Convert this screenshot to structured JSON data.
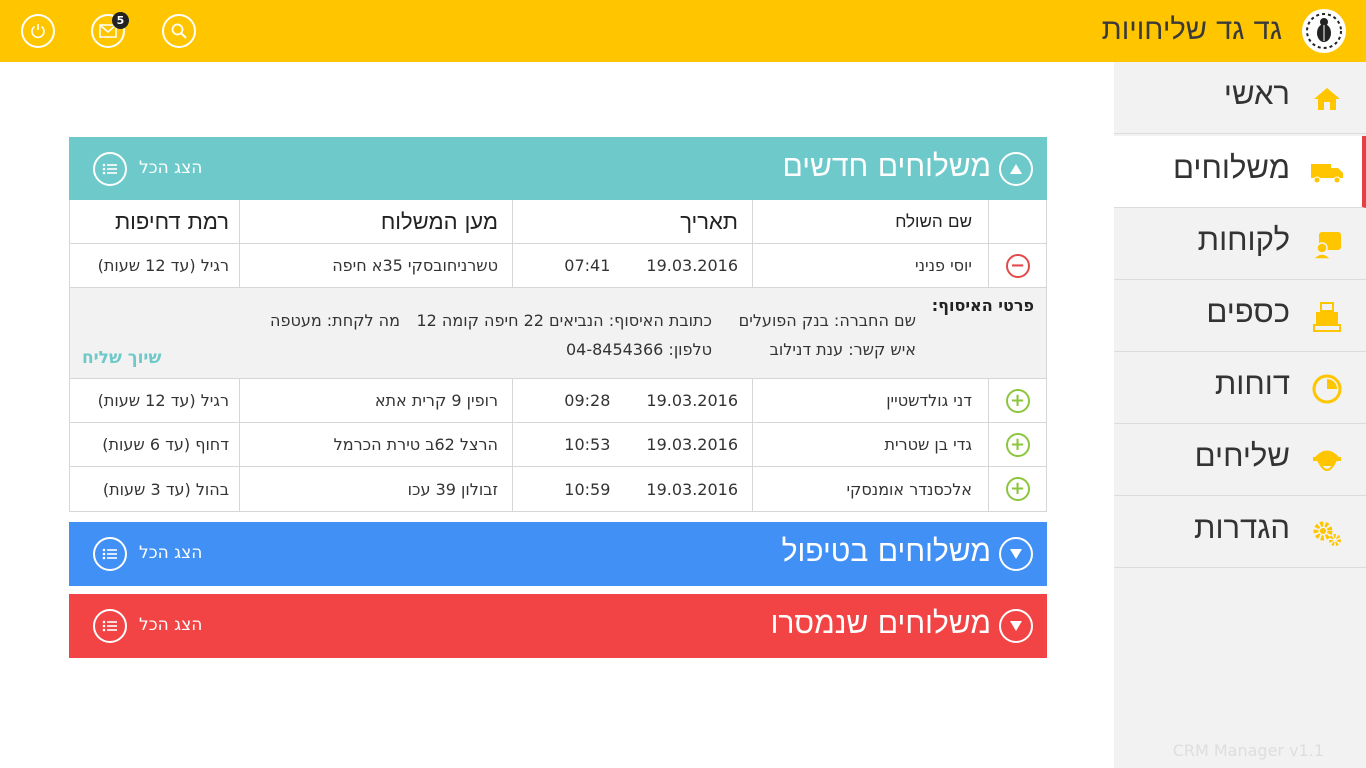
{
  "header": {
    "app_title": "גד גד שליחויות",
    "mail_badge": "5",
    "buttons": [
      "power-icon",
      "mail-icon",
      "search-icon"
    ]
  },
  "sidebar": {
    "items": [
      {
        "label": "ראשי",
        "icon": "home-icon"
      },
      {
        "label": "משלוחים",
        "icon": "truck-icon"
      },
      {
        "label": "לקוחות",
        "icon": "customers-icon"
      },
      {
        "label": "כספים",
        "icon": "cash-register-icon"
      },
      {
        "label": "דוחות",
        "icon": "pie-chart-icon"
      },
      {
        "label": "שליחים",
        "icon": "courier-icon"
      },
      {
        "label": "הגדרות",
        "icon": "gears-icon"
      }
    ],
    "active_index": 1,
    "version": "CRM Manager v1.1"
  },
  "panels": {
    "new": {
      "title": "משלוחים חדשים",
      "show_all": "הצג הכל",
      "color": "#6ecaca"
    },
    "handling": {
      "title": "משלוחים בטיפול",
      "show_all": "הצג הכל",
      "color": "#4190f5"
    },
    "delivered": {
      "title": "משלוחים שנמסרו",
      "show_all": "הצג הכל",
      "color": "#f24444"
    }
  },
  "table": {
    "headers": {
      "sender": "שם השולח",
      "date": "תאריך",
      "address": "מען המשלוח",
      "urgency": "רמת דחיפות"
    },
    "rows": [
      {
        "sender": "יוסי פניני",
        "date": "19.03.2016",
        "time": "07:41",
        "address": "טשרניחובסקי 35א חיפה",
        "urgency": "רגיל (עד 12 שעות)",
        "expanded": true
      },
      {
        "sender": "דני גולדשטיין",
        "date": "19.03.2016",
        "time": "09:28",
        "address": "רופין 9 קרית אתא",
        "urgency": "רגיל (עד 12 שעות)",
        "expanded": false
      },
      {
        "sender": "גדי בן שטרית",
        "date": "19.03.2016",
        "time": "10:53",
        "address": "הרצל 62ב טירת הכרמל",
        "urgency": "דחוף (עד 6 שעות)",
        "expanded": false
      },
      {
        "sender": "אלכסנדר אומנסקי",
        "date": "19.03.2016",
        "time": "10:59",
        "address": "זבולון 39 עכו",
        "urgency": "בהול (עד 3 שעות)",
        "expanded": false
      }
    ],
    "details": {
      "title": "פרטי האיסוף:",
      "company": "שם החברה: בנק הפועלים",
      "contact": "איש קשר: ענת דנילוב",
      "pickup_address": "כתובת האיסוף: הנביאים 22 חיפה קומה 12",
      "phone": "טלפון: 04-8454366",
      "item": "מה לקחת: מעטפה",
      "assign_link": "שיוך שליח"
    }
  }
}
